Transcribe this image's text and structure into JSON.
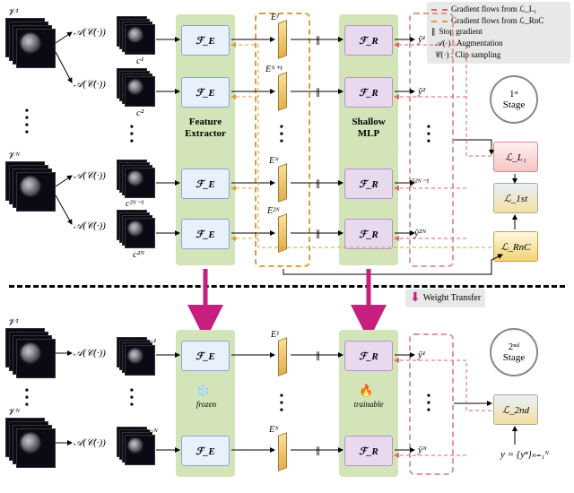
{
  "stage1": {
    "video_labels": [
      "𝒱¹",
      "𝒱ᴺ"
    ],
    "aug_labels": [
      "𝒜(𝒞(·))",
      "𝒜(𝒞(·))",
      "𝒜(𝒞(·))",
      "𝒜(𝒞(·))"
    ],
    "clip_labels": [
      "c¹",
      "c²",
      "c²ᴺ⁻¹",
      "c²ᴺ"
    ],
    "fe_label": "ℱ_E",
    "fr_label": "ℱ_R",
    "fe_column_title": "Feature\nExtractor",
    "fr_column_title": "Shallow\nMLP",
    "embed_labels": [
      "E¹",
      "Eᴺ⁺¹",
      "Eᴺ",
      "E²ᴺ"
    ],
    "output_labels": [
      "ŷ¹",
      "ŷ²",
      "ŷ²ᴺ⁻¹",
      "ŷ²ᴺ"
    ],
    "stage_label_top": "1ˢᵗ",
    "stage_label_bottom": "Stage",
    "loss_l1": "ℒ_L₁",
    "loss_1st": "ℒ_1st",
    "loss_rnc": "ℒ_RnC"
  },
  "stage2": {
    "video_labels": [
      "𝒱¹",
      "𝒱ᴺ"
    ],
    "aug_labels": [
      "𝒜(𝒞(·))",
      "𝒜(𝒞(·))"
    ],
    "clip_labels": [
      "c¹",
      "cᴺ"
    ],
    "fe_label": "ℱ_E",
    "fr_label": "ℱ_R",
    "embed_labels": [
      "E¹",
      "Eᴺ"
    ],
    "output_labels": [
      "ŷ¹",
      "ŷᴺ"
    ],
    "stage_label_top": "2ⁿᵈ",
    "stage_label_bottom": "Stage",
    "loss_2nd": "ℒ_2nd",
    "frozen": "frozen",
    "trainable": "trainable",
    "y_eq": "y = {yⁿ}ₙ₌₁ᴺ"
  },
  "legend": {
    "grad_l1": "Gradient flows from ℒ_L₁",
    "grad_rnc": "Gradient flows from ℒ_RnC",
    "stop_grad": "Stop gradient",
    "aug": "𝒜(·) : Augmentation",
    "clip": "𝒞(·) : Clip sampling"
  },
  "weight_transfer": "Weight Transfer",
  "colors": {
    "grad_l1": "#d66",
    "grad_rnc": "#d9a03a",
    "weight_arrow": "#c61f7f"
  }
}
